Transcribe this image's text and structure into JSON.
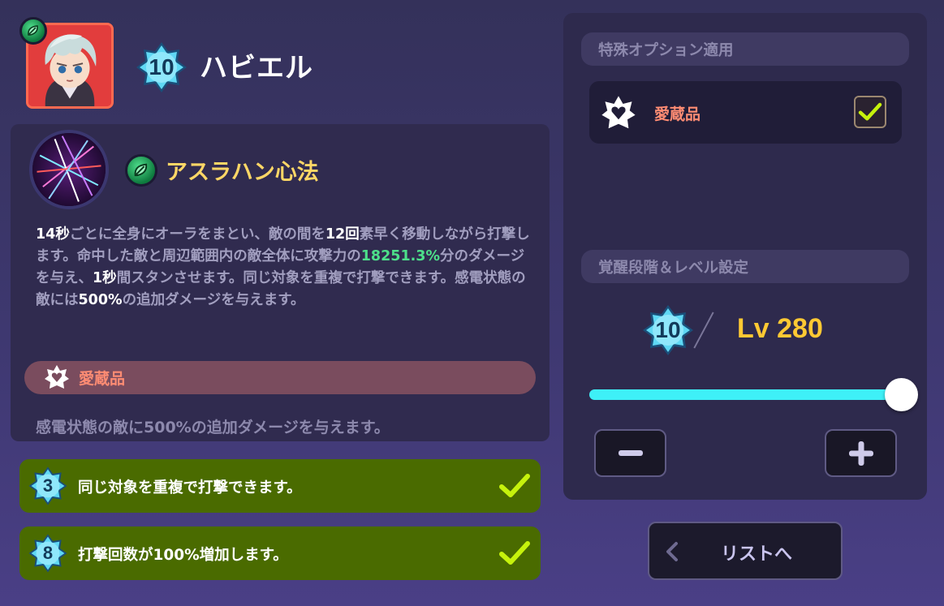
{
  "character": {
    "name": "ハビエル",
    "level_badge": "10"
  },
  "skill": {
    "name": "アスラハン心法",
    "desc_parts": [
      {
        "t": "14秒",
        "c": "hl"
      },
      {
        "t": "ごとに全身にオーラをまとい、敵の間を",
        "c": ""
      },
      {
        "t": "12回",
        "c": "hl"
      },
      {
        "t": "素早く移動しながら打撃します。命中した敵と周辺範囲内の敵全体に攻撃力の",
        "c": ""
      },
      {
        "t": "18251.3%",
        "c": "gr"
      },
      {
        "t": "分のダメージを与え、",
        "c": ""
      },
      {
        "t": "1秒",
        "c": "hl"
      },
      {
        "t": "間スタンさせます。同じ対象を重複で打撃できます。感電状態の敵には",
        "c": ""
      },
      {
        "t": "500%",
        "c": "hl"
      },
      {
        "t": "の追加ダメージを与えます。",
        "c": ""
      }
    ],
    "treasure_label": "愛蔵品",
    "treasure_desc": "感電状態の敵に500%の追加ダメージを与えます。"
  },
  "options": [
    {
      "badge": "3",
      "text": "同じ対象を重複で打撃できます。",
      "checked": true
    },
    {
      "badge": "8",
      "text": "打撃回数が100%増加します。",
      "checked": true
    }
  ],
  "right": {
    "special_header": "特殊オプション適用",
    "treasure_label": "愛蔵品",
    "treasure_checked": true,
    "awaken_header": "覚醒段階＆レベル設定",
    "awaken_badge": "10",
    "level_text": "Lv 280",
    "level_progress": 1.0,
    "minus_label": "−",
    "plus_label": "+",
    "list_button": "リストへ"
  },
  "colors": {
    "accent_cyan": "#3ef0f7",
    "level_gold": "#ffc933",
    "skill_name_gold": "#ffd766",
    "treasure_orange": "#ff8c73",
    "option_green": "#4a6b00",
    "check_lime": "#c6f20c"
  }
}
